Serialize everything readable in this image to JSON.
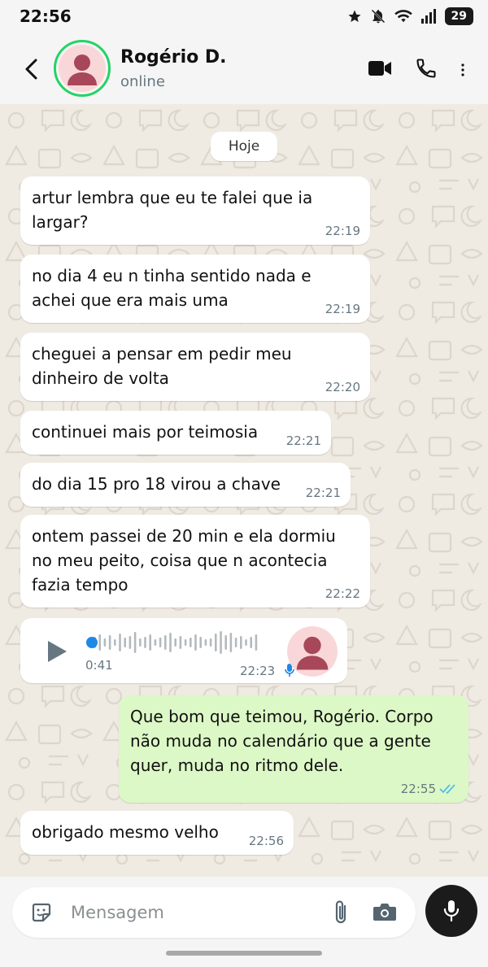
{
  "status_bar": {
    "time": "22:56",
    "battery": "29"
  },
  "header": {
    "contact_name": "Rogério D.",
    "contact_status": "online"
  },
  "chat": {
    "date_label": "Hoje",
    "messages": [
      {
        "text": "artur lembra que eu te falei que ia largar?",
        "time": "22:19"
      },
      {
        "text": "no dia 4 eu n tinha sentido nada e achei que era mais uma",
        "time": "22:19"
      },
      {
        "text": "cheguei a pensar em pedir meu dinheiro de volta",
        "time": "22:20"
      },
      {
        "text": "continuei mais por teimosia",
        "time": "22:21"
      },
      {
        "text": "do dia 15 pro 18 virou a chave",
        "time": "22:21"
      },
      {
        "text": "ontem passei de 20 min e ela dormiu no meu peito, coisa que n acontecia fazia tempo",
        "time": "22:22"
      },
      {
        "duration": "0:41",
        "time": "22:23",
        "played": 0.0
      },
      {
        "text": "Que bom que teimou, Rogério. Corpo não muda no calendário que a gente quer, muda no ritmo dele.",
        "time": "22:55"
      },
      {
        "text": "obrigado mesmo velho",
        "time": "22:56"
      }
    ]
  },
  "composer": {
    "placeholder": "Mensagem"
  },
  "colors": {
    "accent_green": "#25d366",
    "outgoing_bubble": "#dcf8c6",
    "read_ticks": "#53bdeb",
    "voice_accent": "#1e88e5"
  }
}
